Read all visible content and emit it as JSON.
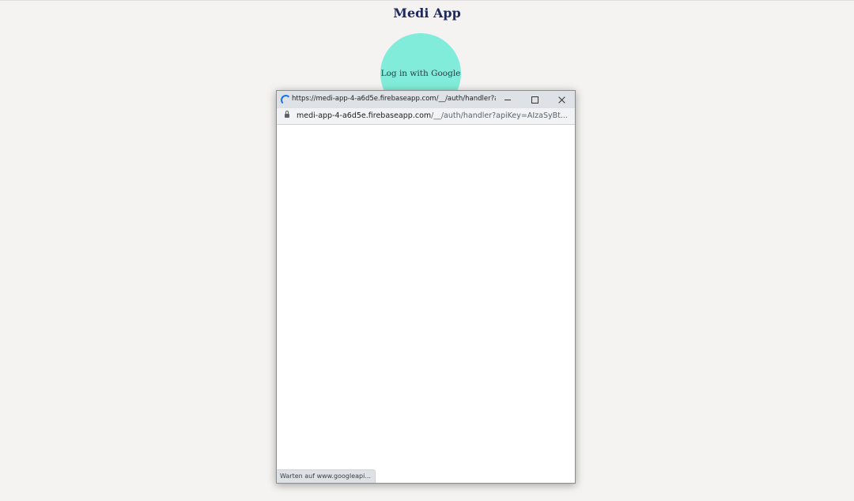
{
  "app": {
    "title": "Medi App",
    "login_button_label": "Log in with Google"
  },
  "popup": {
    "window_title": "https://medi-app-4-a6d5e.firebaseapp.com/__/auth/handler?a...",
    "address_host": "medi-app-4-a6d5e.firebaseapp.com",
    "address_path": "/__/auth/handler?apiKey=AIzaSyBt...",
    "status_text": "Warten auf www.googleapi...",
    "icons": {
      "loading": "spinner-icon",
      "minimize": "minimize-icon",
      "maximize": "maximize-icon",
      "close": "close-icon",
      "secure": "lock-icon"
    }
  },
  "colors": {
    "background": "#f4f3f2",
    "title": "#1f2a5c",
    "login_circle": "#81ecd9",
    "spinner": "#1a73e8"
  }
}
